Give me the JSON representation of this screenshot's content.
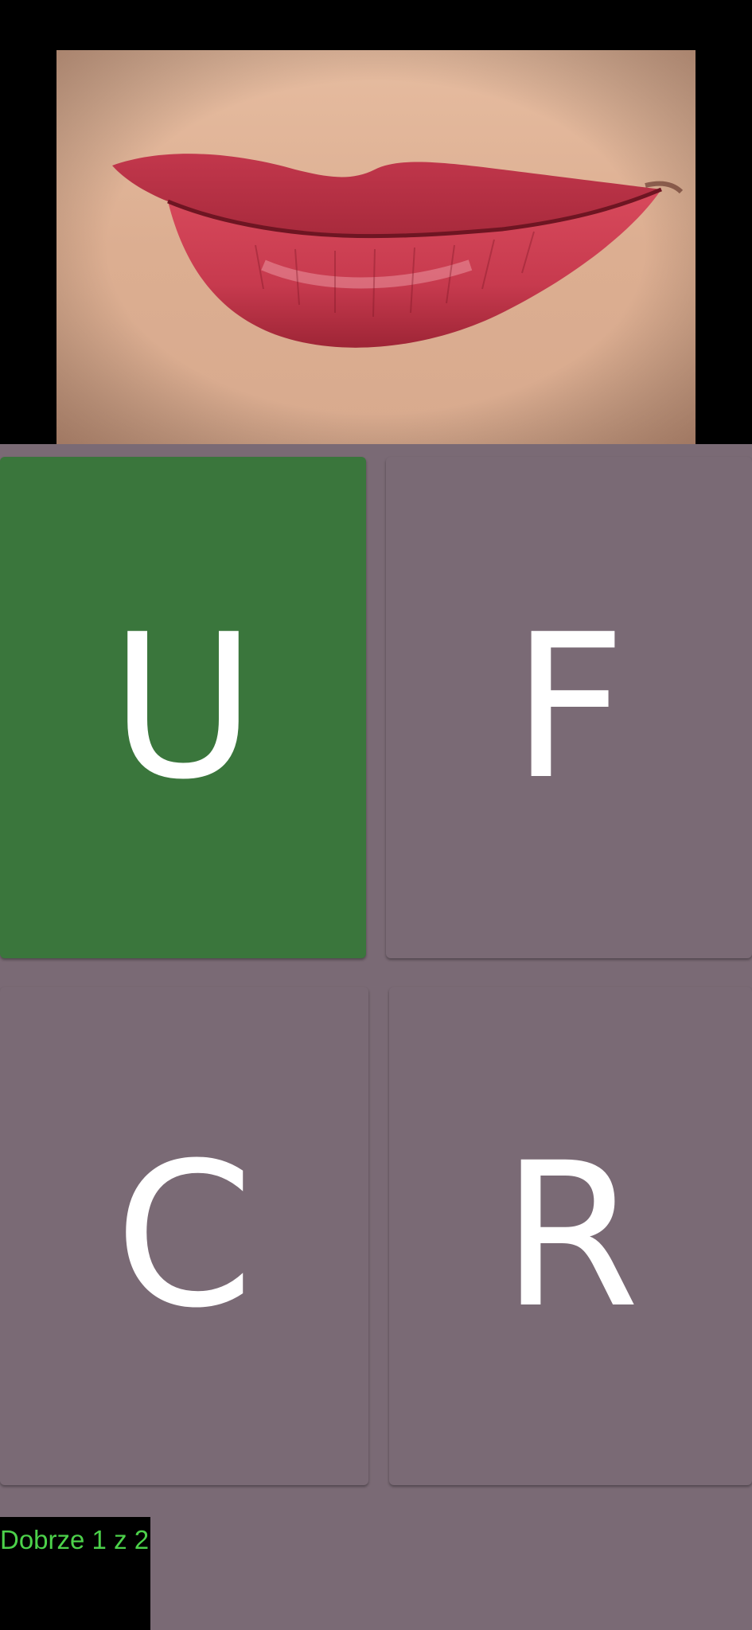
{
  "prompt_image": {
    "icon": "lips-photo",
    "description_colors": {
      "skin": "#e0b497",
      "lip": "#c8344a"
    }
  },
  "answers": [
    {
      "label": "U",
      "state": "correct"
    },
    {
      "label": "F",
      "state": "neutral"
    },
    {
      "label": "C",
      "state": "neutral"
    },
    {
      "label": "R",
      "state": "neutral"
    }
  ],
  "score": {
    "text": "Dobrze 1 z 2"
  },
  "colors": {
    "correct": "#3a763c",
    "neutral": "#7a6a75",
    "score_text": "#4cd14a"
  }
}
